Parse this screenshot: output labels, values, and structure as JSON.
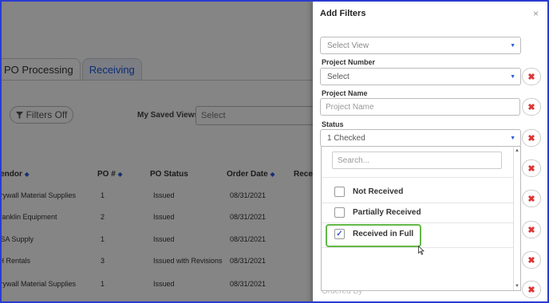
{
  "app": {
    "tabs": [
      "PO Processing",
      "Receiving"
    ],
    "filters_button": "Filters Off",
    "saved_views_label": "My Saved Views",
    "saved_views_placeholder": "Select",
    "columns": [
      "Vendor",
      "PO #",
      "PO Status",
      "Order Date",
      "Recei"
    ],
    "rows": [
      {
        "vendor": "Drywall Material Supplies",
        "po": "1",
        "status": "Issued",
        "date": "08/31/2021"
      },
      {
        "vendor": "Franklin Equipment",
        "po": "2",
        "status": "Issued",
        "date": "08/31/2021"
      },
      {
        "vendor": "USA Supply",
        "po": "1",
        "status": "Issued",
        "date": "08/31/2021"
      },
      {
        "vendor": "JH Rentals",
        "po": "3",
        "status": "Issued with Revisions",
        "date": "08/31/2021"
      },
      {
        "vendor": "Drywall Material Supplies",
        "po": "1",
        "status": "Issued",
        "date": "08/31/2021"
      }
    ]
  },
  "panel": {
    "title": "Add Filters",
    "close": "×",
    "view_select": "Select View",
    "project_number": {
      "label": "Project Number",
      "value": "Select"
    },
    "project_name": {
      "label": "Project Name",
      "placeholder": "Project Name"
    },
    "status": {
      "label": "Status",
      "value": "1 Checked"
    },
    "remove_label": "✖",
    "ghost_label": "Ordered By",
    "dropdown": {
      "search_placeholder": "Search...",
      "options": [
        {
          "label": "Not Received",
          "checked": false
        },
        {
          "label": "Partially Received",
          "checked": false
        },
        {
          "label": "Received in Full",
          "checked": true
        }
      ],
      "check_mark": "✓"
    }
  },
  "colors": {
    "accent": "#2a5bd7",
    "highlight": "#62b847",
    "remove": "#d33333",
    "frame": "#2a3bd0"
  }
}
